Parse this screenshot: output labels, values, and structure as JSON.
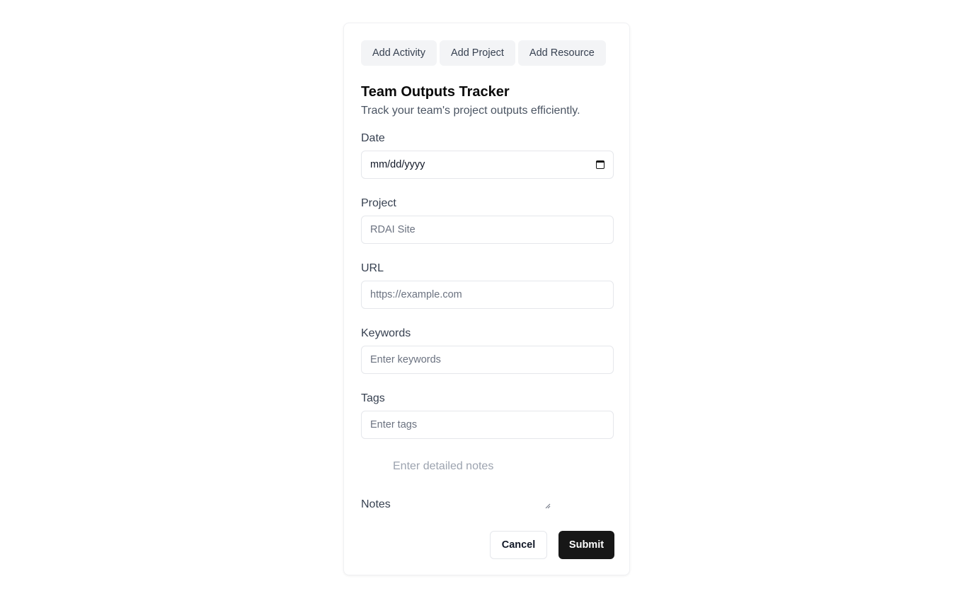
{
  "tabs": {
    "add_activity": "Add Activity",
    "add_project": "Add Project",
    "add_resource": "Add Resource"
  },
  "header": {
    "title": "Team Outputs Tracker",
    "subtitle": "Track your team's project outputs efficiently."
  },
  "form": {
    "date": {
      "label": "Date",
      "value": "mm/dd/yyyy",
      "icon": "calendar-icon"
    },
    "project": {
      "label": "Project",
      "placeholder": "RDAI Site"
    },
    "url": {
      "label": "URL",
      "placeholder": "https://example.com"
    },
    "keywords": {
      "label": "Keywords",
      "placeholder": "Enter keywords"
    },
    "tags": {
      "label": "Tags",
      "placeholder": "Enter tags"
    },
    "notes": {
      "label": "Notes",
      "placeholder": "Enter detailed notes"
    }
  },
  "actions": {
    "cancel_label": "Cancel",
    "submit_label": "Submit"
  },
  "colors": {
    "tab_bg": "#f3f4f6",
    "primary": "#171717",
    "border": "#e5e7eb"
  }
}
